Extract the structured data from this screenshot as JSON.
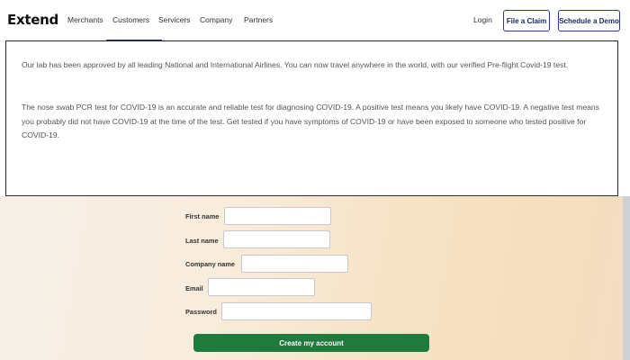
{
  "header": {
    "logo": "Extend",
    "nav": [
      {
        "label": "Merchants"
      },
      {
        "label": "Customers"
      },
      {
        "label": "Servicers"
      },
      {
        "label": "Company"
      },
      {
        "label": "Partners"
      }
    ],
    "login_label": "Login",
    "file_claim_label": "File a Claim",
    "schedule_demo_label": "Schedule a Demo"
  },
  "info": {
    "paragraph_1": "Our lab has been approved by all leading National and International Airlines. You can now travel anywhere in the world, with our verified Pre-flight Covid-19 test.",
    "paragraph_2": "The nose swab PCR test for COVID-19 is an accurate and reliable test for diagnosing COVID-19. A positive test means you likely have COVID-19. A negative test means you probably did not have COVID-19 at the time of the test. Get tested if you have symptoms of COVID-19 or have been exposed to someone who tested positive for COVID-19."
  },
  "form": {
    "first_name_label": "First name",
    "last_name_label": "Last name",
    "company_name_label": "Company name",
    "email_label": "Email",
    "password_label": "Password",
    "first_name_value": "",
    "last_name_value": "",
    "company_name_value": "",
    "email_value": "",
    "password_value": "",
    "submit_label": "Create my account"
  },
  "colors": {
    "brand_navy": "#1c2a66",
    "submit_green": "#1f7a3d"
  }
}
